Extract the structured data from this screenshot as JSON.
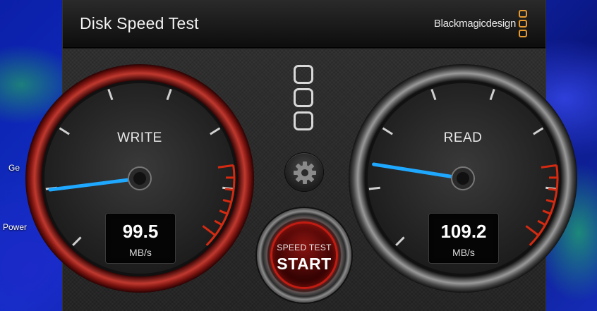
{
  "desktop": {
    "labels": [
      "Ge",
      "Power"
    ]
  },
  "window": {
    "title": "Disk Speed Test",
    "brand": "Blackmagicdesign",
    "close_glyph": "✕"
  },
  "gauges": {
    "write": {
      "label": "WRITE",
      "value": "99.5",
      "unit": "MB/s",
      "needle_level": 0.14
    },
    "read": {
      "label": "READ",
      "value": "109.2",
      "unit": "MB/s",
      "needle_level": 0.2
    }
  },
  "controls": {
    "settings_icon": "gear-icon",
    "start_top": "SPEED TEST",
    "start_main": "START"
  },
  "colors": {
    "accent_red": "#d42a12",
    "needle_blue": "#1fa8ff",
    "brand_orange": "#e79a2e"
  }
}
